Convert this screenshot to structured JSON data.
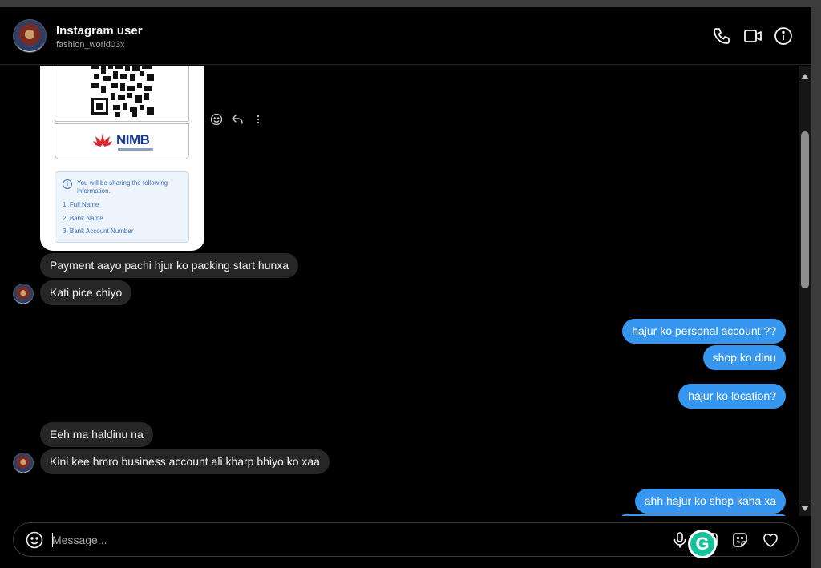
{
  "header": {
    "title": "Instagram user",
    "username": "fashion_world03x"
  },
  "payment_card": {
    "bank_name": "NIMB",
    "info_heading": "You will be sharing the following information.",
    "info_items": [
      "1. Full Name",
      "2. Bank Name",
      "3. Bank Account Number"
    ]
  },
  "messages": [
    {
      "from": "them",
      "text": "Payment aayo pachi hjur ko packing start hunxa"
    },
    {
      "from": "them",
      "text": "Kati pice chiyo"
    },
    {
      "from": "me",
      "text": "hajur ko personal account ??"
    },
    {
      "from": "me",
      "text": "shop ko dinu"
    },
    {
      "from": "me",
      "text": "hajur ko location?"
    },
    {
      "from": "them",
      "text": "Eeh ma haldinu na"
    },
    {
      "from": "them",
      "text": "Kini kee hmro business account ali kharp bhiyo ko xaa"
    },
    {
      "from": "me",
      "text": "ahh hajur ko shop kaha xa"
    }
  ],
  "composer": {
    "placeholder": "Message..."
  },
  "colors": {
    "background": "#000000",
    "incoming_bubble": "#262626",
    "outgoing_bubble": "#3797f0",
    "grammarly": "#15c39a"
  },
  "icons": [
    "phone-icon",
    "video-icon",
    "info-icon",
    "emoji-icon",
    "reply-icon",
    "more-icon",
    "microphone-icon",
    "image-icon",
    "sticker-icon",
    "heart-icon",
    "grammarly-icon"
  ]
}
